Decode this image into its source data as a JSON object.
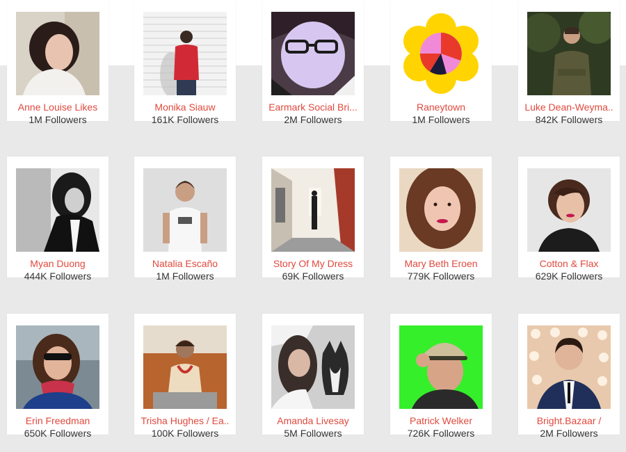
{
  "profiles": [
    {
      "name": "Anne Louise Likes",
      "followers": "1M Followers"
    },
    {
      "name": "Monika Siauw",
      "followers": "161K Followers"
    },
    {
      "name": "Earmark Social Bri...",
      "followers": "2M Followers"
    },
    {
      "name": "Raneytown",
      "followers": "1M Followers"
    },
    {
      "name": "Luke Dean-Weyma..",
      "followers": "842K Followers"
    },
    {
      "name": "Myan Duong",
      "followers": "444K Followers"
    },
    {
      "name": "Natalia Escaño",
      "followers": "1M Followers"
    },
    {
      "name": "Story Of My Dress",
      "followers": "69K Followers"
    },
    {
      "name": "Mary Beth Eroen",
      "followers": "779K Followers"
    },
    {
      "name": "Cotton & Flax",
      "followers": "629K Followers"
    },
    {
      "name": "Erin Freedman",
      "followers": "650K Followers"
    },
    {
      "name": "Trisha Hughes / Ea..",
      "followers": "100K Followers"
    },
    {
      "name": "Amanda Livesay",
      "followers": "5M Followers"
    },
    {
      "name": "Patrick Welker",
      "followers": "726K Followers"
    },
    {
      "name": "Bright.Bazaar /",
      "followers": "2M Followers"
    }
  ],
  "colors": {
    "name_text": "#e0493d",
    "followers_text": "#333333",
    "page_background": "#e9e9e9",
    "card_background": "#ffffff"
  }
}
